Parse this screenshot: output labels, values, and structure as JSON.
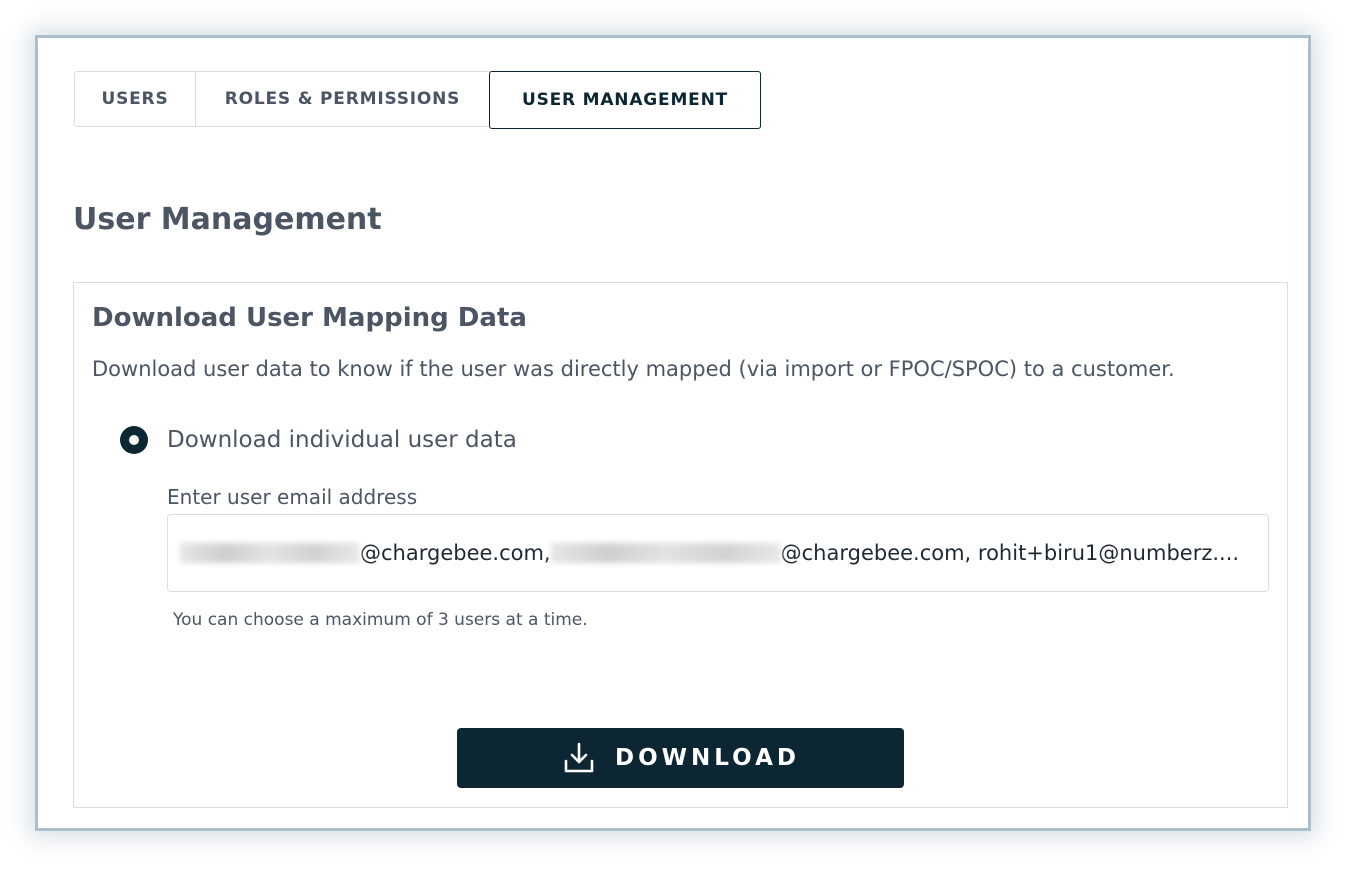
{
  "tabs": [
    {
      "label": "USERS",
      "active": false
    },
    {
      "label": "ROLES & PERMISSIONS",
      "active": false
    },
    {
      "label": "USER MANAGEMENT",
      "active": true
    }
  ],
  "page": {
    "title": "User Management"
  },
  "download_section": {
    "title": "Download User Mapping Data",
    "description": "Download user data to know if the user was directly mapped (via import or FPOC/SPOC) to a customer.",
    "radio_option": {
      "label": "Download individual user data",
      "selected": true
    },
    "email_field": {
      "label": "Enter user email address",
      "value_segments": [
        "@chargebee.com,",
        "@chargebee.com, rohit+biru1@numberz...."
      ],
      "redacted_parts": 2
    },
    "hint": "You can choose a maximum of 3 users at a time.",
    "download_button": {
      "label": "DOWNLOAD",
      "icon": "download-icon"
    }
  },
  "colors": {
    "primary": "#0c2733",
    "text": "#4b5563",
    "border": "#d9dde1",
    "frame_border": "#a9c0cc"
  }
}
